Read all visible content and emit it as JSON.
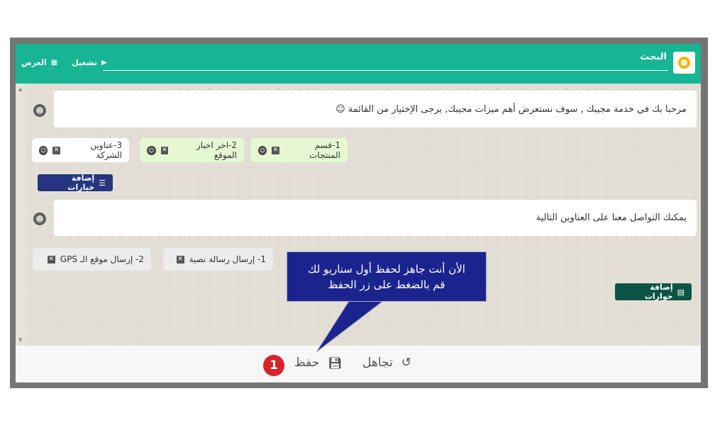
{
  "header": {
    "search_label": "البحث",
    "run_label": "تشغيل",
    "view_label": "العرض"
  },
  "messages": [
    {
      "text": "مرحبا بك في خدمة مجيبك , سوف نستعرض أهم ميزات مجيبك, يرجى الإختيار من القائمة ☺"
    },
    {
      "text": "يمكنك التواصل معنا على العناوين التالية"
    }
  ],
  "options_row1": [
    {
      "label": "1-قسم المنتجات"
    },
    {
      "label": "2-اخر اخبار الموقع"
    },
    {
      "label": "3-عناوين الشركة"
    }
  ],
  "options_row2": [
    {
      "label": "1- إرسال رسالة نصية"
    },
    {
      "label": "2- إرسال موقع الـ GPS"
    }
  ],
  "buttons": {
    "add_options": "إضافة خيارات",
    "add_dialogs": "إضافة حوارات"
  },
  "footer": {
    "save_label": "حفظ",
    "ignore_label": "تجاهل"
  },
  "callout": {
    "line1": "الأن أنت جاهز لحفظ أول سناريو لك",
    "line2": "قم بالضغط على زر الحفظ"
  },
  "badge": "1",
  "colors": {
    "header": "#17b593",
    "navy_button": "#26357f",
    "teal_button": "#0e5445",
    "callout": "#1b248e",
    "badge": "#d6242a"
  }
}
